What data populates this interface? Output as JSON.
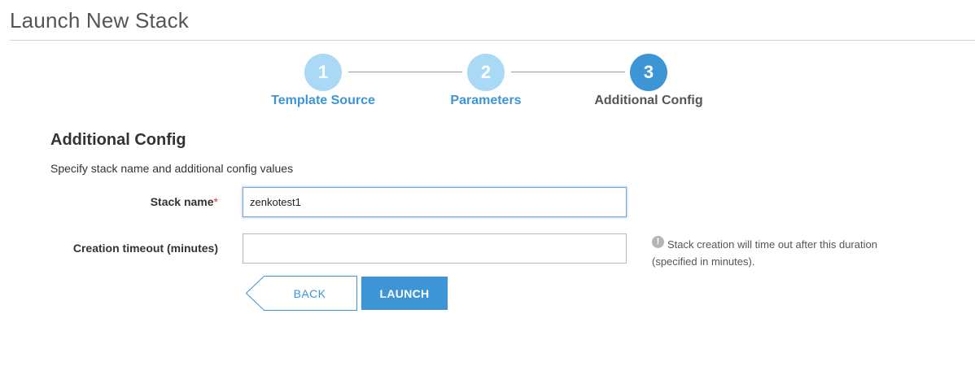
{
  "page": {
    "title": "Launch New Stack"
  },
  "stepper": {
    "steps": [
      {
        "number": "1",
        "label": "Template Source",
        "state": "done"
      },
      {
        "number": "2",
        "label": "Parameters",
        "state": "done"
      },
      {
        "number": "3",
        "label": "Additional Config",
        "state": "active"
      }
    ]
  },
  "section": {
    "title": "Additional Config",
    "description": "Specify stack name and additional config values"
  },
  "form": {
    "stack_name": {
      "label": "Stack name",
      "required_marker": "*",
      "value": "zenkotest1"
    },
    "creation_timeout": {
      "label": "Creation timeout (minutes)",
      "value": "",
      "help_icon": "exclamation-circle-icon",
      "help_icon_glyph": "!",
      "help_text": "Stack creation will time out after this duration (specified in minutes)."
    }
  },
  "actions": {
    "back_label": "BACK",
    "launch_label": "LAUNCH"
  },
  "colors": {
    "accent": "#3e95d6",
    "step_done": "#a9d9f5",
    "required": "#d9322c"
  }
}
